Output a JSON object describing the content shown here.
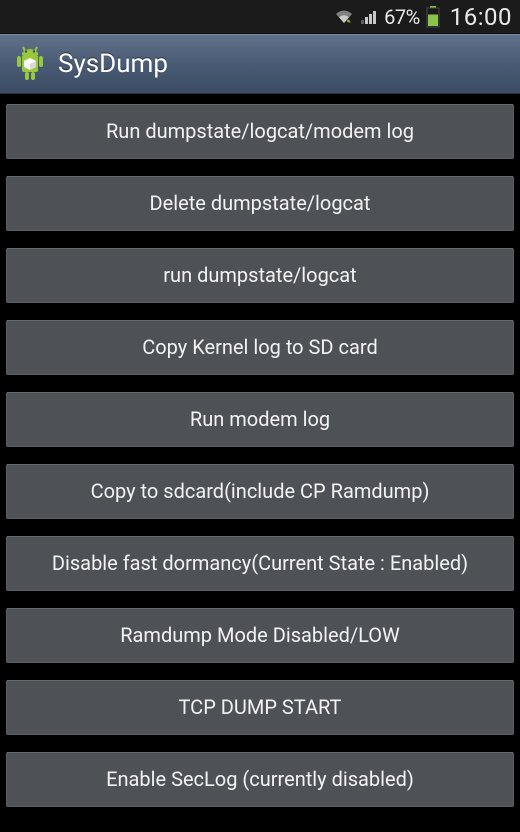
{
  "statusbar": {
    "battery_pct": "67%",
    "clock": "16:00"
  },
  "header": {
    "title": "SysDump"
  },
  "buttons": [
    "Run dumpstate/logcat/modem log",
    "Delete dumpstate/logcat",
    "run dumpstate/logcat",
    "Copy Kernel log to SD card",
    "Run modem log",
    "Copy to sdcard(include CP Ramdump)",
    "Disable fast dormancy(Current State : Enabled)",
    "Ramdump Mode Disabled/LOW",
    "TCP DUMP START",
    "Enable SecLog (currently disabled)"
  ]
}
